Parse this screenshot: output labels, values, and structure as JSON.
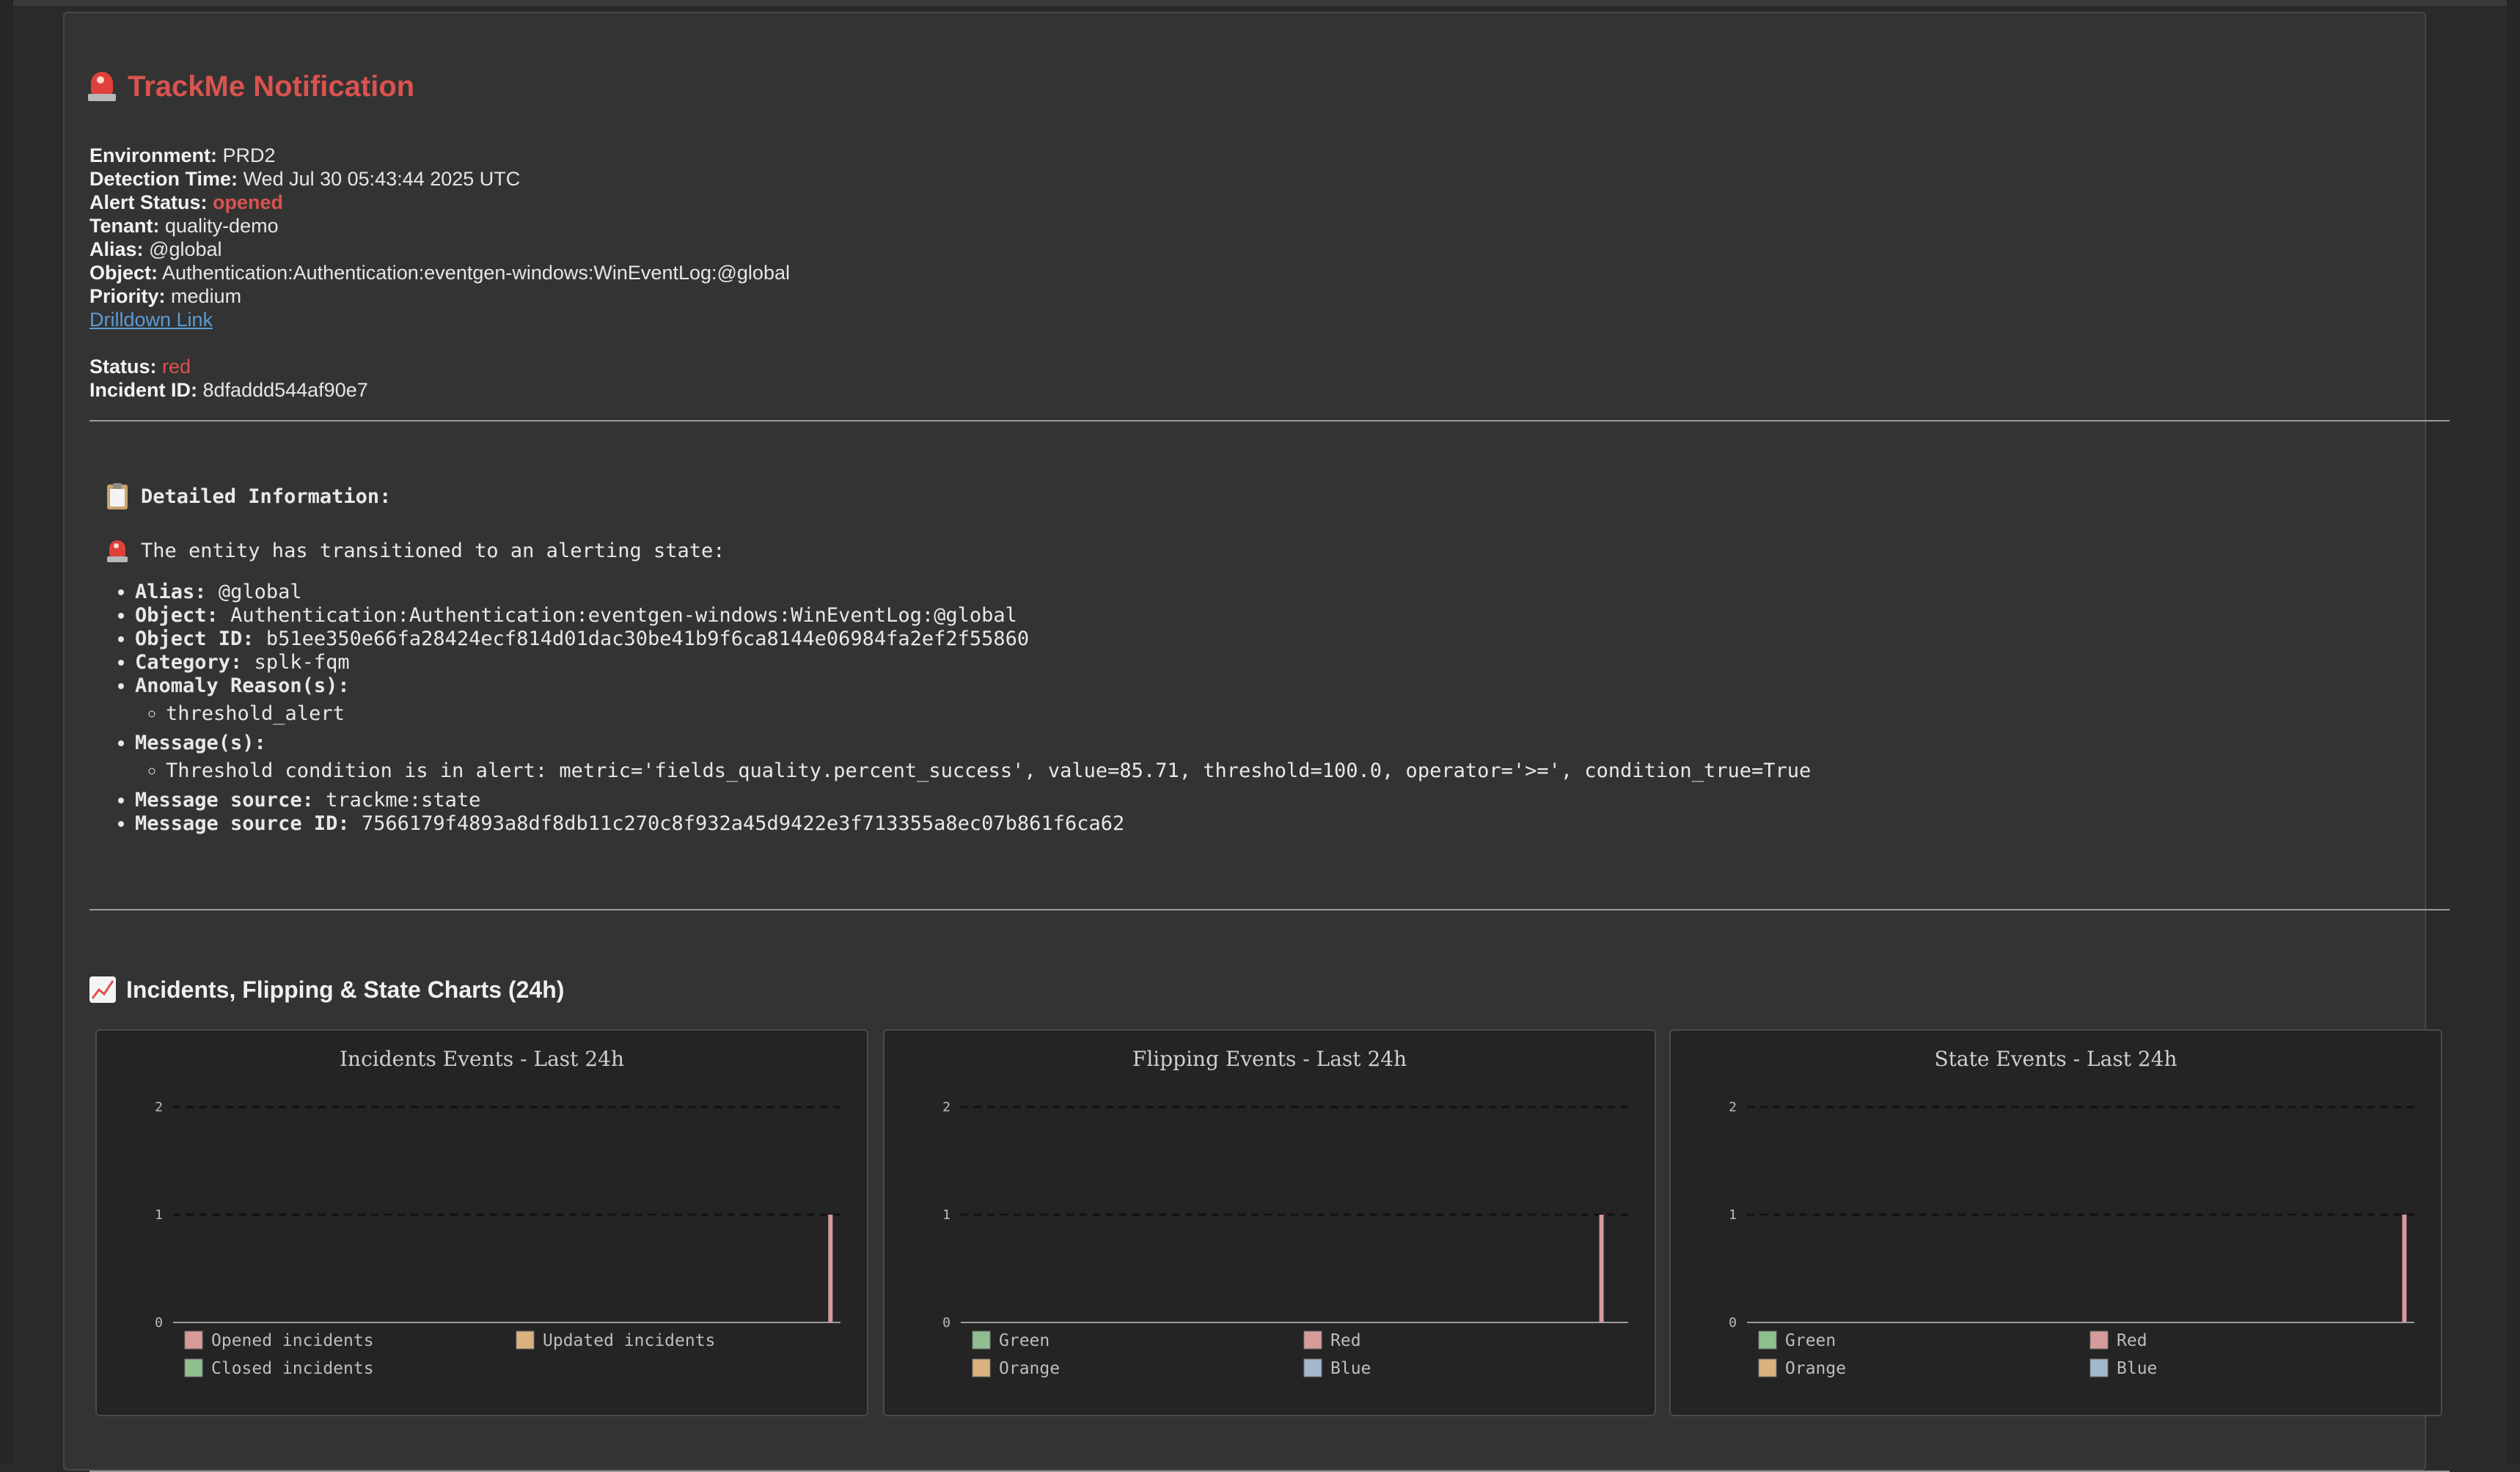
{
  "title": "TrackMe Notification",
  "fields": {
    "environment": {
      "label": "Environment:",
      "value": "PRD2"
    },
    "detection_time": {
      "label": "Detection Time:",
      "value": "Wed Jul 30 05:43:44 2025 UTC"
    },
    "alert_status": {
      "label": "Alert Status:",
      "value": "opened"
    },
    "tenant": {
      "label": "Tenant:",
      "value": "quality-demo"
    },
    "alias": {
      "label": "Alias:",
      "value": "@global"
    },
    "object": {
      "label": "Object:",
      "value": "Authentication:Authentication:eventgen-windows:WinEventLog:@global"
    },
    "priority": {
      "label": "Priority:",
      "value": "medium"
    },
    "drilldown": "Drilldown Link",
    "status": {
      "label": "Status:",
      "value": "red"
    },
    "incident_id": {
      "label": "Incident ID:",
      "value": "8dfaddd544af90e7"
    }
  },
  "detail": {
    "header": "Detailed Information:",
    "intro": "The entity has transitioned to an alerting state:",
    "alias": {
      "label": "Alias:",
      "value": "@global"
    },
    "object": {
      "label": "Object:",
      "value": "Authentication:Authentication:eventgen-windows:WinEventLog:@global"
    },
    "object_id": {
      "label": "Object ID:",
      "value": "b51ee350e66fa28424ecf814d01dac30be41b9f6ca8144e06984fa2ef2f55860"
    },
    "category": {
      "label": "Category:",
      "value": "splk-fqm"
    },
    "anomaly": {
      "label": "Anomaly Reason(s):",
      "items": [
        "threshold_alert"
      ]
    },
    "message": {
      "label": "Message(s):",
      "items": [
        "Threshold condition is in alert: metric='fields_quality.percent_success', value=85.71, threshold=100.0, operator='>=', condition_true=True"
      ]
    },
    "message_source": {
      "label": "Message source:",
      "value": "trackme:state"
    },
    "message_source_id": {
      "label": "Message source ID:",
      "value": "7566179f4893a8df8db11c270c8f932a45d9422e3f713355a8ec07b861f6ca62"
    }
  },
  "charts_header": "Incidents, Flipping & State Charts (24h)",
  "colors": {
    "red": "#d9534f",
    "link": "#5b9bd5",
    "series_red": "#d79a9a",
    "series_green": "#8fbf8f",
    "series_orange": "#d8b27f",
    "series_blue": "#a3b8cc"
  },
  "chart_data": [
    {
      "type": "bar",
      "title": "Incidents Events - Last 24h",
      "ylim": [
        0,
        2
      ],
      "yticks": [
        "0",
        "1",
        "2"
      ],
      "grid": true,
      "legend_position": "bottom",
      "series": [
        {
          "name": "Opened incidents",
          "color": "#d79a9a",
          "points": [
            {
              "pos": 0.985,
              "value": 1
            }
          ]
        },
        {
          "name": "Updated incidents",
          "color": "#d8b27f",
          "points": []
        },
        {
          "name": "Closed incidents",
          "color": "#8fbf8f",
          "points": []
        }
      ]
    },
    {
      "type": "bar",
      "title": "Flipping Events - Last 24h",
      "ylim": [
        0,
        2
      ],
      "yticks": [
        "0",
        "1",
        "2"
      ],
      "grid": true,
      "legend_position": "bottom",
      "series": [
        {
          "name": "Green",
          "color": "#8fbf8f",
          "points": []
        },
        {
          "name": "Red",
          "color": "#d79a9a",
          "points": [
            {
              "pos": 0.96,
              "value": 1
            }
          ]
        },
        {
          "name": "Orange",
          "color": "#d8b27f",
          "points": []
        },
        {
          "name": "Blue",
          "color": "#a3b8cc",
          "points": []
        }
      ]
    },
    {
      "type": "bar",
      "title": "State Events - Last 24h",
      "ylim": [
        0,
        2
      ],
      "yticks": [
        "0",
        "1",
        "2"
      ],
      "grid": true,
      "legend_position": "bottom",
      "series": [
        {
          "name": "Green",
          "color": "#8fbf8f",
          "points": []
        },
        {
          "name": "Red",
          "color": "#d79a9a",
          "points": [
            {
              "pos": 0.985,
              "value": 1
            }
          ]
        },
        {
          "name": "Orange",
          "color": "#d8b27f",
          "points": []
        },
        {
          "name": "Blue",
          "color": "#a3b8cc",
          "points": []
        }
      ]
    }
  ]
}
